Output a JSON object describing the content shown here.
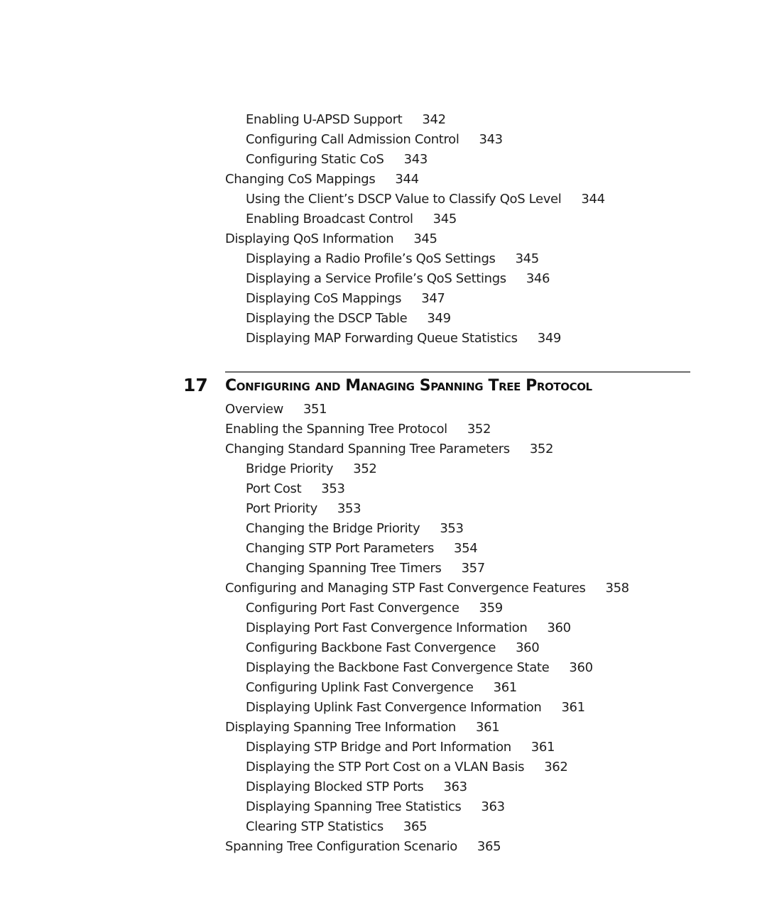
{
  "toc_before": [
    {
      "level": 2,
      "title": "Enabling U-APSD Support",
      "page": "342"
    },
    {
      "level": 2,
      "title": "Configuring Call Admission Control",
      "page": "343"
    },
    {
      "level": 2,
      "title": "Configuring Static CoS",
      "page": "343"
    },
    {
      "level": 1,
      "title": "Changing CoS Mappings",
      "page": "344"
    },
    {
      "level": 2,
      "title": "Using the Client’s DSCP Value to Classify QoS Level",
      "page": "344"
    },
    {
      "level": 2,
      "title": "Enabling Broadcast Control",
      "page": "345"
    },
    {
      "level": 1,
      "title": "Displaying QoS Information",
      "page": "345"
    },
    {
      "level": 2,
      "title": "Displaying a Radio Profile’s QoS Settings",
      "page": "345"
    },
    {
      "level": 2,
      "title": "Displaying a Service Profile’s QoS Settings",
      "page": "346"
    },
    {
      "level": 2,
      "title": "Displaying CoS Mappings",
      "page": "347"
    },
    {
      "level": 2,
      "title": "Displaying the DSCP Table",
      "page": "349"
    },
    {
      "level": 2,
      "title": "Displaying MAP Forwarding Queue Statistics",
      "page": "349"
    }
  ],
  "chapter": {
    "number": "17",
    "title": "Configuring and Managing Spanning Tree Protocol"
  },
  "toc_chapter": [
    {
      "level": 1,
      "title": "Overview",
      "page": "351"
    },
    {
      "level": 1,
      "title": "Enabling the Spanning Tree Protocol",
      "page": "352"
    },
    {
      "level": 1,
      "title": "Changing Standard Spanning Tree Parameters",
      "page": "352"
    },
    {
      "level": 2,
      "title": "Bridge Priority",
      "page": "352"
    },
    {
      "level": 2,
      "title": "Port Cost",
      "page": "353"
    },
    {
      "level": 2,
      "title": "Port Priority",
      "page": "353"
    },
    {
      "level": 2,
      "title": "Changing the Bridge Priority",
      "page": "353"
    },
    {
      "level": 2,
      "title": "Changing STP Port Parameters",
      "page": "354"
    },
    {
      "level": 2,
      "title": "Changing Spanning Tree Timers",
      "page": "357"
    },
    {
      "level": 1,
      "title": "Configuring and Managing STP Fast Convergence Features",
      "page": "358"
    },
    {
      "level": 2,
      "title": "Configuring Port Fast Convergence",
      "page": "359"
    },
    {
      "level": 2,
      "title": "Displaying Port Fast Convergence Information",
      "page": "360"
    },
    {
      "level": 2,
      "title": "Configuring Backbone Fast Convergence",
      "page": "360"
    },
    {
      "level": 2,
      "title": "Displaying the Backbone Fast Convergence State",
      "page": "360"
    },
    {
      "level": 2,
      "title": "Configuring Uplink Fast Convergence",
      "page": "361"
    },
    {
      "level": 2,
      "title": "Displaying Uplink Fast Convergence Information",
      "page": "361"
    },
    {
      "level": 1,
      "title": "Displaying Spanning Tree Information",
      "page": "361"
    },
    {
      "level": 2,
      "title": "Displaying STP Bridge and Port Information",
      "page": "361"
    },
    {
      "level": 2,
      "title": "Displaying the STP Port Cost on a VLAN Basis",
      "page": "362"
    },
    {
      "level": 2,
      "title": "Displaying Blocked STP Ports",
      "page": "363"
    },
    {
      "level": 2,
      "title": "Displaying Spanning Tree Statistics",
      "page": "363"
    },
    {
      "level": 2,
      "title": "Clearing STP Statistics",
      "page": "365"
    },
    {
      "level": 1,
      "title": "Spanning Tree Configuration Scenario",
      "page": "365"
    }
  ]
}
